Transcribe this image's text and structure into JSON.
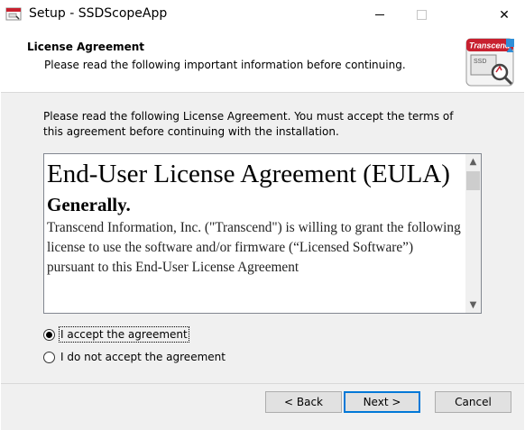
{
  "window": {
    "title": "Setup - SSDScopeApp",
    "icon": "setup-app-icon",
    "controls": {
      "minimize": "minimize-icon",
      "maximize": "maximize-icon",
      "close": "close-icon",
      "close_glyph": "✕"
    }
  },
  "header": {
    "title": "License Agreement",
    "subtitle": "Please read the following important information before continuing.",
    "logo_text": "Transcend",
    "logo_sub": "SSD"
  },
  "body": {
    "intro": "Please read the following License Agreement. You must accept the terms of this agreement before continuing with the installation.",
    "eula": {
      "heading": "End-User License Agreement (EULA)",
      "subheading": "Generally.",
      "paragraph": "Transcend Information, Inc. (\"Transcend\") is willing to grant the following license to use the software and/or firmware (“Licensed Software”) pursuant to this End-User License Agreement"
    },
    "radios": {
      "accept": {
        "label": "I accept the agreement",
        "checked": true
      },
      "decline": {
        "label": "I do not accept the agreement",
        "checked": false
      }
    }
  },
  "footer": {
    "back_label": "< Back",
    "next_label": "Next >",
    "cancel_label": "Cancel"
  },
  "colors": {
    "accent": "#0078d7",
    "logo_red": "#c8202f",
    "panel": "#f0f0f0"
  }
}
